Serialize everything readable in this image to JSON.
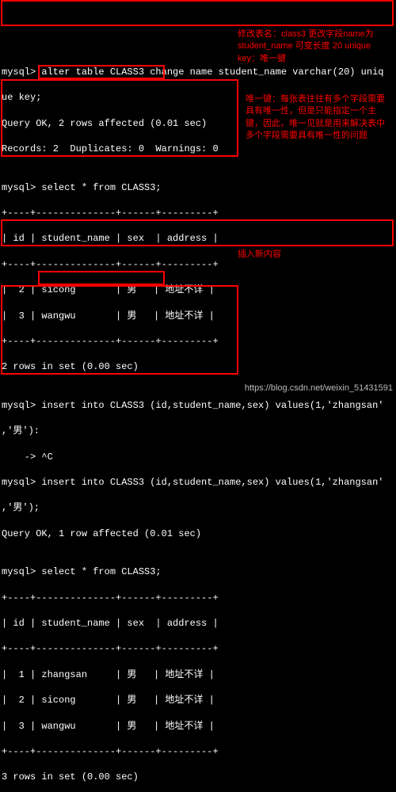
{
  "lines": {
    "l0": "mysql> alter table CLASS3 change name student_name varchar(20) uniq",
    "l1": "ue key;",
    "l2": "Query OK, 2 rows affected (0.01 sec)",
    "l3": "Records: 2  Duplicates: 0  Warnings: 0",
    "l4": "",
    "l5": "mysql> select * from CLASS3;",
    "l6": "+----+--------------+------+---------+",
    "l7": "| id | student_name | sex  | address |",
    "l8": "+----+--------------+------+---------+",
    "l9": "|  2 | sicong       | 男   | 地址不详 |",
    "l10": "|  3 | wangwu       | 男   | 地址不详 |",
    "l11": "+----+--------------+------+---------+",
    "l12": "2 rows in set (0.00 sec)",
    "l13": "",
    "l14": "mysql> insert into CLASS3 (id,student_name,sex) values(1,'zhangsan'",
    "l15": ",'男'):",
    "l16": "    -> ^C",
    "l17": "mysql> insert into CLASS3 (id,student_name,sex) values(1,'zhangsan'",
    "l18": ",'男');",
    "l19": "Query OK, 1 row affected (0.01 sec)",
    "l20": "",
    "l21": "mysql> select * from CLASS3;",
    "l22": "+----+--------------+------+---------+",
    "l23": "| id | student_name | sex  | address |",
    "l24": "+----+--------------+------+---------+",
    "l25": "|  1 | zhangsan     | 男   | 地址不详 |",
    "l26": "|  2 | sicong       | 男   | 地址不详 |",
    "l27": "|  3 | wangwu       | 男   | 地址不详 |",
    "l28": "+----+--------------+------+---------+",
    "l29": "3 rows in set (0.00 sec)"
  },
  "annotations": {
    "a1": "修改表名：class3 更改字段name为student_name 可变长度 20 unique key：唯一键",
    "a2": "唯一键：每张表往往有多个字段需要具有唯一性，但是只能指定一个主键，因此，唯一见就是用来解决表中多个字段需要具有唯一性的问题",
    "a3": "插入新内容"
  },
  "watermark": "https://blog.csdn.net/weixin_51431591"
}
